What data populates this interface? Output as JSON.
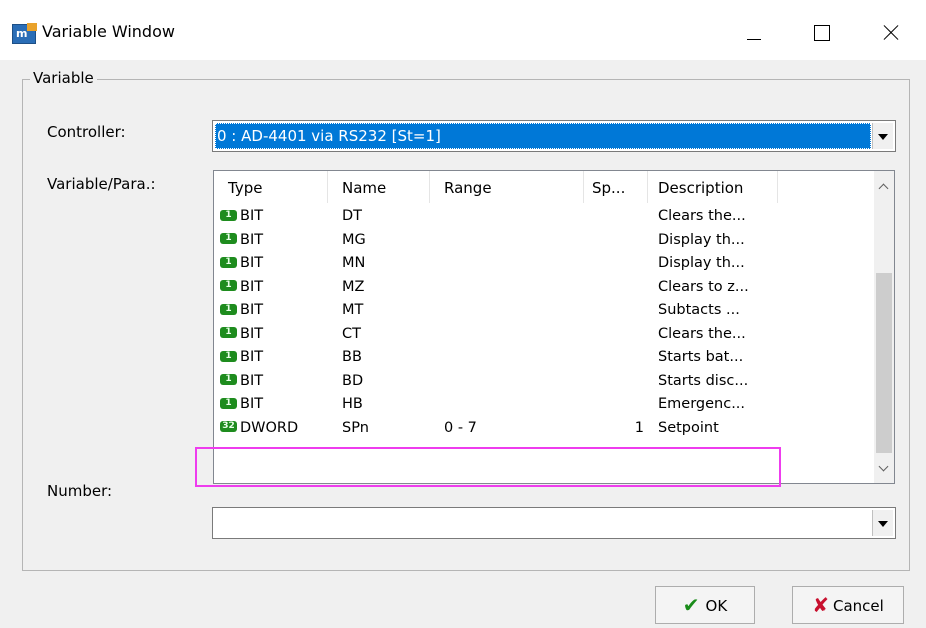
{
  "window": {
    "title": "Variable Window",
    "controls": {
      "minimize": "minimize",
      "maximize": "maximize",
      "close": "close"
    }
  },
  "group": {
    "label": "Variable"
  },
  "controller": {
    "label": "Controller:",
    "value": "0 : AD-4401 via RS232 [St=1]"
  },
  "variable": {
    "label": "Variable/Para.:",
    "columns": [
      "Type",
      "Name",
      "Range",
      "Sp...",
      "Description"
    ],
    "rows": [
      {
        "badge": "1",
        "type": "BIT",
        "name": "DT",
        "range": "",
        "size": "",
        "description": "Clears the..."
      },
      {
        "badge": "1",
        "type": "BIT",
        "name": "MG",
        "range": "",
        "size": "",
        "description": "Display th..."
      },
      {
        "badge": "1",
        "type": "BIT",
        "name": "MN",
        "range": "",
        "size": "",
        "description": "Display th..."
      },
      {
        "badge": "1",
        "type": "BIT",
        "name": "MZ",
        "range": "",
        "size": "",
        "description": "Clears to z..."
      },
      {
        "badge": "1",
        "type": "BIT",
        "name": "MT",
        "range": "",
        "size": "",
        "description": "Subtacts ..."
      },
      {
        "badge": "1",
        "type": "BIT",
        "name": "CT",
        "range": "",
        "size": "",
        "description": "Clears the..."
      },
      {
        "badge": "1",
        "type": "BIT",
        "name": "BB",
        "range": "",
        "size": "",
        "description": "Starts bat..."
      },
      {
        "badge": "1",
        "type": "BIT",
        "name": "BD",
        "range": "",
        "size": "",
        "description": "Starts disc..."
      },
      {
        "badge": "1",
        "type": "BIT",
        "name": "HB",
        "range": "",
        "size": "",
        "description": "Emergenc..."
      },
      {
        "badge": "32",
        "type": "DWORD",
        "name": "SPn",
        "range": "0 - 7",
        "size": "1",
        "description": "Setpoint"
      }
    ]
  },
  "number": {
    "label": "Number:",
    "value": ""
  },
  "buttons": {
    "ok": "OK",
    "cancel": "Cancel"
  },
  "colors": {
    "accent": "#0078d7",
    "badge": "#1e8c1e",
    "highlight": "#ee3cee"
  }
}
